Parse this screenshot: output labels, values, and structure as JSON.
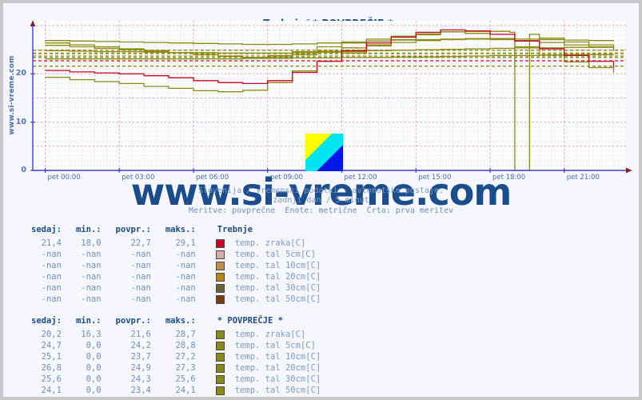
{
  "site": {
    "vertical_label": "www.si-vreme.com",
    "watermark": "www.si-vreme.com"
  },
  "header": {
    "station_a": "Trebnje",
    "separator": "&",
    "station_b": "* POVPREČJE *",
    "title_full": "Trebnje & * POVPREČJE *"
  },
  "captions": {
    "line1": "Slovenija / vremenski podatki - avtomatske postaje.",
    "line2": "zadnji dan / 5 minut",
    "line3": "Meritve: povprečne  Enote: metrične  Črta: prva meritev"
  },
  "axes": {
    "y_ticks": [
      "0",
      "10",
      "20"
    ],
    "x_ticks": [
      "pet 00:00",
      "pet 03:00",
      "pet 06:00",
      "pet 09:00",
      "pet 12:00",
      "pet 15:00",
      "pet 18:00",
      "pet 21:00"
    ],
    "ylim": [
      0,
      30
    ],
    "grid": true
  },
  "colors": {
    "axis": "#4040c8",
    "title": "#15508f",
    "label": "#4a6fa5",
    "value": "#6f90bb",
    "background": "#f5f7fd",
    "page_border": "#c8c8c8",
    "series_zraka_trebnje": "#cc0022",
    "series_tal5_trebnje": "#d9aaa6",
    "series_tal10_trebnje": "#c28c4a",
    "series_tal20_trebnje": "#b8860b",
    "series_tal30_trebnje": "#6b6238",
    "series_tal50_trebnje": "#7a3b0a",
    "series_povprecje": "#8a8a10"
  },
  "legend_headers": {
    "sedaj": "sedaj:",
    "min": "min.:",
    "povpr": "povpr.:",
    "maks": "maks.:"
  },
  "legend_trebnje": {
    "name": "Trebnje",
    "rows": [
      {
        "sedaj": "21,4",
        "min": "18,0",
        "povpr": "22,7",
        "maks": "29,1",
        "label": "temp. zraka[C]",
        "color": "#cc0022"
      },
      {
        "sedaj": "-nan",
        "min": "-nan",
        "povpr": "-nan",
        "maks": "-nan",
        "label": "temp. tal  5cm[C]",
        "color": "#d9aaa6"
      },
      {
        "sedaj": "-nan",
        "min": "-nan",
        "povpr": "-nan",
        "maks": "-nan",
        "label": "temp. tal 10cm[C]",
        "color": "#c28c4a"
      },
      {
        "sedaj": "-nan",
        "min": "-nan",
        "povpr": "-nan",
        "maks": "-nan",
        "label": "temp. tal 20cm[C]",
        "color": "#b8860b"
      },
      {
        "sedaj": "-nan",
        "min": "-nan",
        "povpr": "-nan",
        "maks": "-nan",
        "label": "temp. tal 30cm[C]",
        "color": "#6b6238"
      },
      {
        "sedaj": "-nan",
        "min": "-nan",
        "povpr": "-nan",
        "maks": "-nan",
        "label": "temp. tal 50cm[C]",
        "color": "#7a3b0a"
      }
    ]
  },
  "legend_povprecje": {
    "name": "* POVPREČJE *",
    "rows": [
      {
        "sedaj": "20,2",
        "min": "16,3",
        "povpr": "21,6",
        "maks": "28,7",
        "label": "temp. zraka[C]",
        "color": "#8a8a10"
      },
      {
        "sedaj": "24,7",
        "min": "0,0",
        "povpr": "24,2",
        "maks": "28,8",
        "label": "temp. tal  5cm[C]",
        "color": "#8a8a10"
      },
      {
        "sedaj": "25,1",
        "min": "0,0",
        "povpr": "23,7",
        "maks": "27,2",
        "label": "temp. tal 10cm[C]",
        "color": "#8a8a10"
      },
      {
        "sedaj": "26,8",
        "min": "0,0",
        "povpr": "24,9",
        "maks": "27,3",
        "label": "temp. tal 20cm[C]",
        "color": "#8a8a10"
      },
      {
        "sedaj": "25,6",
        "min": "0,0",
        "povpr": "24,3",
        "maks": "25,6",
        "label": "temp. tal 30cm[C]",
        "color": "#8a8a10"
      },
      {
        "sedaj": "24,1",
        "min": "0,0",
        "povpr": "23,4",
        "maks": "24,1",
        "label": "temp. tal 50cm[C]",
        "color": "#8a8a10"
      }
    ]
  },
  "chart_data": {
    "type": "line",
    "title": "Trebnje & * POVPREČJE *",
    "xlabel": "",
    "ylabel": "",
    "ylim": [
      0,
      30
    ],
    "grid": true,
    "legend_position": "below",
    "x_tick_labels": [
      "pet 00:00",
      "pet 03:00",
      "pet 06:00",
      "pet 09:00",
      "pet 12:00",
      "pet 15:00",
      "pet 18:00",
      "pet 21:00"
    ],
    "x_tick_hours": [
      0,
      3,
      6,
      9,
      12,
      15,
      18,
      21
    ],
    "x_hours_range": [
      -0.5,
      23.5
    ],
    "series": [
      {
        "name": "Trebnje temp. zraka[C]",
        "color": "#cc0022",
        "reference_line": 22.7,
        "x": [
          0,
          1,
          2,
          3,
          4,
          5,
          6,
          7,
          8,
          9,
          10,
          11,
          12,
          13,
          14,
          15,
          16,
          17,
          18,
          19,
          20,
          21,
          22,
          23
        ],
        "values": [
          20.7,
          20.4,
          20.2,
          20.0,
          19.6,
          19.2,
          18.6,
          18.2,
          18.0,
          18.6,
          20.3,
          22.6,
          24.8,
          26.4,
          27.6,
          28.6,
          29.1,
          28.9,
          28.2,
          26.8,
          25.2,
          23.8,
          22.6,
          21.4
        ]
      },
      {
        "name": "* POVPREČJE * temp. zraka[C]",
        "color": "#8a8a10",
        "reference_line": 21.6,
        "x": [
          0,
          1,
          2,
          3,
          4,
          5,
          6,
          7,
          8,
          9,
          10,
          11,
          12,
          13,
          14,
          15,
          16,
          17,
          18,
          19,
          20,
          21,
          22,
          23
        ],
        "values": [
          19.3,
          18.8,
          18.4,
          18.0,
          17.4,
          17.0,
          16.5,
          16.3,
          16.6,
          18.2,
          20.6,
          22.6,
          24.3,
          25.8,
          27.1,
          28.1,
          28.7,
          28.4,
          27.3,
          25.6,
          23.9,
          22.5,
          21.3,
          20.2
        ]
      },
      {
        "name": "* POVPREČJE * temp. tal  5cm[C]",
        "color": "#8a8a10",
        "reference_line": 24.2,
        "x": [
          0,
          1,
          2,
          3,
          4,
          5,
          6,
          7,
          8,
          9,
          10,
          11,
          12,
          13,
          14,
          15,
          16,
          17,
          18,
          18.8,
          19.0,
          19.4,
          19.6,
          20,
          21,
          22,
          23
        ],
        "values": [
          26.4,
          26.0,
          25.6,
          25.2,
          24.8,
          24.4,
          24.0,
          23.6,
          23.4,
          23.8,
          24.6,
          25.6,
          26.4,
          27.2,
          27.8,
          28.3,
          28.7,
          28.8,
          28.8,
          28.6,
          0.0,
          0.0,
          28.2,
          27.4,
          26.6,
          26.0,
          24.7
        ]
      },
      {
        "name": "* POVPREČJE * temp. tal 10cm[C]",
        "color": "#8a8a10",
        "reference_line": 23.7,
        "x": [
          0,
          1,
          2,
          3,
          4,
          5,
          6,
          7,
          8,
          9,
          10,
          11,
          12,
          13,
          14,
          15,
          16,
          17,
          18,
          19,
          20,
          21,
          22,
          23
        ],
        "values": [
          25.9,
          25.6,
          25.3,
          25.0,
          24.7,
          24.4,
          24.0,
          23.7,
          23.4,
          23.5,
          24.0,
          24.7,
          25.4,
          26.0,
          26.5,
          26.9,
          27.1,
          27.2,
          27.1,
          26.9,
          26.5,
          26.0,
          25.6,
          25.1
        ]
      },
      {
        "name": "* POVPREČJE * temp. tal 20cm[C]",
        "color": "#8a8a10",
        "reference_line": 24.9,
        "x": [
          0,
          1,
          2,
          3,
          4,
          5,
          6,
          7,
          8,
          9,
          10,
          11,
          12,
          13,
          14,
          15,
          16,
          17,
          18,
          19,
          20,
          21,
          22,
          23
        ],
        "values": [
          26.9,
          26.8,
          26.7,
          26.6,
          26.5,
          26.4,
          26.3,
          26.2,
          26.1,
          26.1,
          26.2,
          26.4,
          26.6,
          26.8,
          27.0,
          27.1,
          27.2,
          27.3,
          27.3,
          27.2,
          27.1,
          27.0,
          26.9,
          26.8
        ]
      },
      {
        "name": "* POVPREČJE * temp. tal 30cm[C]",
        "color": "#8a8a10",
        "reference_line": 24.3,
        "x": [
          0,
          1,
          2,
          3,
          4,
          5,
          6,
          7,
          8,
          9,
          10,
          11,
          12,
          13,
          14,
          15,
          16,
          17,
          18,
          19,
          20,
          21,
          22,
          23
        ],
        "values": [
          24.8,
          24.7,
          24.6,
          24.6,
          24.5,
          24.4,
          24.4,
          24.3,
          24.3,
          24.3,
          24.4,
          24.5,
          24.6,
          24.8,
          24.9,
          25.0,
          25.1,
          25.2,
          25.3,
          25.4,
          25.4,
          25.5,
          25.5,
          25.6
        ]
      },
      {
        "name": "* POVPREČJE * temp. tal 50cm[C]",
        "color": "#8a8a10",
        "reference_line": 23.4,
        "x": [
          0,
          1,
          2,
          3,
          4,
          5,
          6,
          7,
          8,
          9,
          10,
          11,
          12,
          13,
          14,
          15,
          16,
          17,
          18,
          19,
          20,
          21,
          22,
          23
        ],
        "values": [
          23.1,
          23.1,
          23.1,
          23.1,
          23.1,
          23.1,
          23.1,
          23.1,
          23.2,
          23.2,
          23.3,
          23.3,
          23.4,
          23.4,
          23.5,
          23.5,
          23.6,
          23.7,
          23.8,
          23.8,
          23.9,
          24.0,
          24.0,
          24.1
        ]
      }
    ]
  }
}
